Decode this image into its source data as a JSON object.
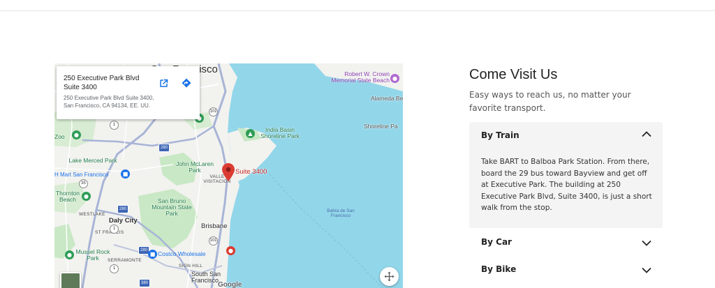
{
  "map": {
    "card": {
      "title": "250 Executive Park Blvd Suite 3400",
      "address": "250 Executive Park Blvd Suite 3400, San Francisco, CA 94134, EE. UU."
    },
    "labels": {
      "san_francisco": "San Francisco",
      "robert_crown": "Robert W. Crown Memorial State Beach",
      "alameda": "Alameda Bea",
      "shoreline": "Shoreline Pa",
      "india_basin": "India Basin Shoreline Park",
      "zoo": "Zoo",
      "lake_merced": "Lake Merced Park",
      "walmart": "H Mart San Francisco",
      "thornton": "Thornton Beach",
      "john_mclaren": "John McLaren Park",
      "visitacion": "VALLE VISITACIÓN",
      "suite": "Suite 3400",
      "bahia": "Bahía de San Francisco",
      "westlake": "WESTLAKE",
      "daly_city": "Daly City",
      "st_francis": "ST FRANCIS",
      "san_bruno": "San Bruno Mountain State Park",
      "brisbane": "Brisbane",
      "mussel_rock": "Mussel Rock Park",
      "serramonte": "SERRAMONTE",
      "costco": "Costco Wholesale",
      "sign_hill": "SIGN HILL",
      "south_sf": "South San Francisco",
      "google": "Google"
    },
    "shields": [
      "101",
      "1",
      "280",
      "35",
      "280",
      "1",
      "101",
      "280",
      "380",
      "1"
    ]
  },
  "visit": {
    "title": "Come Visit Us",
    "subtitle": "Easy ways to reach us, no matter your favorite transport."
  },
  "accordion": [
    {
      "label": "By Train",
      "expanded": true,
      "body": "Take BART to Balboa Park Station. From there, board the 29 bus toward Bayview and get off at Executive Park. The building at 250 Executive Park Blvd, Suite 3400, is just a short walk from the stop."
    },
    {
      "label": "By Car",
      "expanded": false
    },
    {
      "label": "By Bike",
      "expanded": false
    }
  ],
  "colors": {
    "water": "#92d6ea",
    "land": "#f2f2ef",
    "park": "#c9e8c5",
    "pin": "#db3c32",
    "accent_blue": "#1a73e8"
  },
  "icons": [
    "open-in-new-icon",
    "directions-icon",
    "map-pin-icon",
    "fullscreen-icon",
    "chevron-up-icon",
    "chevron-down-icon"
  ]
}
